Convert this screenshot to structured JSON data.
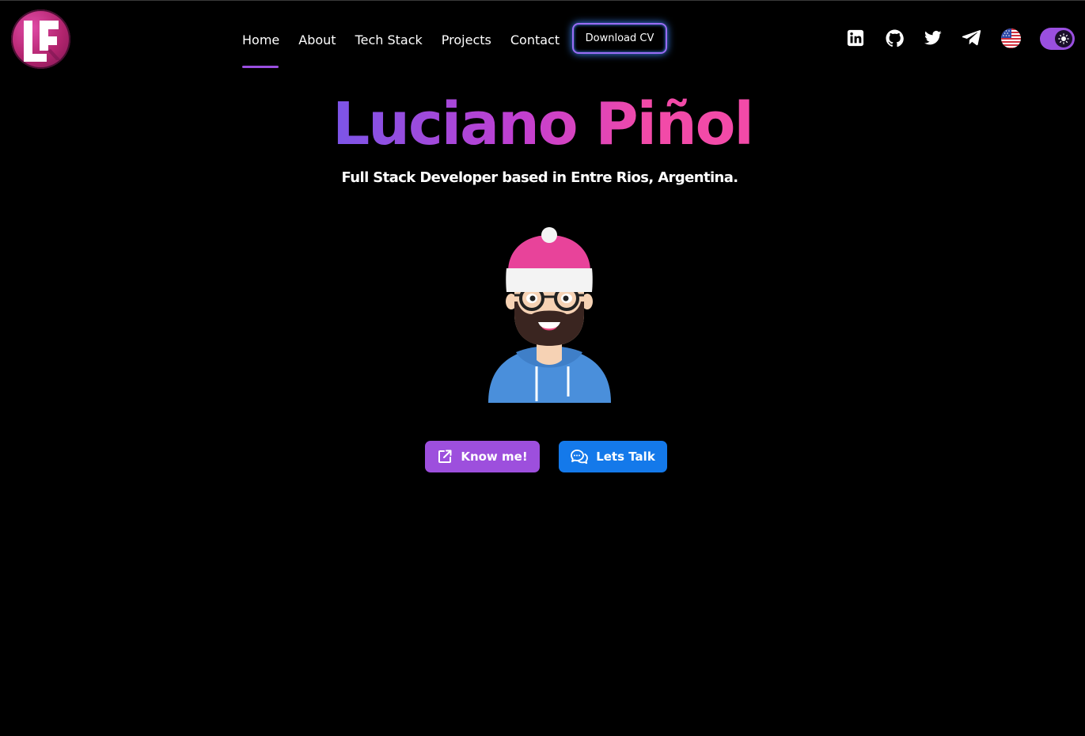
{
  "logo": {
    "alt_letters": "LP",
    "color": "#b2246e"
  },
  "nav": {
    "items": [
      {
        "label": "Home",
        "active": true
      },
      {
        "label": "About",
        "active": false
      },
      {
        "label": "Tech Stack",
        "active": false
      },
      {
        "label": "Projects",
        "active": false
      },
      {
        "label": "Contact",
        "active": false
      }
    ],
    "active_color": "#9a4fe0",
    "cv_button_label": "Download CV"
  },
  "social": {
    "icons": [
      "linkedin-icon",
      "github-icon",
      "twitter-icon",
      "telegram-icon"
    ],
    "language_flag": "us-flag-icon",
    "theme_toggle": {
      "icon": "sun-icon",
      "state": "dark"
    }
  },
  "hero": {
    "title": "Luciano Piñol",
    "subtitle": "Full Stack Developer based in Entre Rios, Argentina.",
    "title_gradient": [
      "#7b55e8",
      "#f24aa8"
    ]
  },
  "actions": {
    "know_me_label": "Know me!",
    "know_me_icon": "external-link-icon",
    "know_me_color": "#9d4fdd",
    "lets_talk_label": "Lets Talk",
    "lets_talk_icon": "chat-bubbles-icon",
    "lets_talk_color": "#1479ea"
  }
}
